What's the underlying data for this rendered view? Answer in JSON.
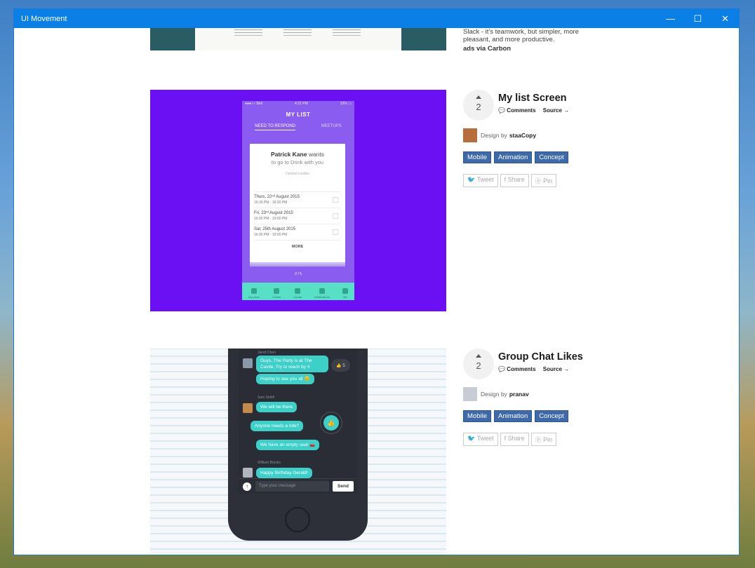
{
  "window": {
    "title": "UI Movement",
    "minimize": "—",
    "maximize": "☐",
    "close": "✕"
  },
  "ad": {
    "text": "Slack - it's teamwork, but simpler, more pleasant, and more productive.",
    "via": "ads via Carbon"
  },
  "items": [
    {
      "title": "My list Screen",
      "votes": "2",
      "comments": "Comments",
      "source": "Source →",
      "design_by": "Design by",
      "designer": "staaCopy",
      "tags": [
        "Mobile",
        "Animation",
        "Concept"
      ],
      "share": {
        "tweet": "Tweet",
        "share": "Share",
        "pin": "Pin"
      },
      "mock": {
        "status_left": "●●●○○ Bell",
        "status_time": "4:21 PM",
        "status_right": "22% ▭",
        "heading": "MY LIST",
        "tab_active": "NEED TO RESPOND",
        "tab_other": "MEETUPS",
        "person": "Patrick Kane",
        "wants": " wants",
        "goal": "to go to  Drink  with you",
        "location": "Central London",
        "rows": [
          {
            "date": "Thurs, 22ⁿᵈ August 2015",
            "time": "19:30 PM - 19:30 PM"
          },
          {
            "date": "Fri, 23ʳᵈ August 2015",
            "time": "16:00 PM - 19:00 PM"
          },
          {
            "date": "Sat, 25th August 2015",
            "time": "16:00 PM - 19:00 PM"
          }
        ],
        "more": "MORE",
        "pager": "2 / 5",
        "nav": [
          "My plans",
          "Circles",
          "Create",
          "Notifications",
          "Me"
        ]
      }
    },
    {
      "title": "Group Chat Likes",
      "votes": "2",
      "comments": "Comments",
      "source": "Source →",
      "design_by": "Design by",
      "designer": "pranav",
      "tags": [
        "Mobile",
        "Animation",
        "Concept"
      ],
      "share": {
        "tweet": "Tweet",
        "share": "Share",
        "pin": "Pin"
      },
      "mock": {
        "sender1": "Jared Chen",
        "msg1": "Guys, The Party is at The Castle, Try to reach by 4",
        "msg2": "Hoping to see you all 😊",
        "likes": "👍 5",
        "sender2": "Sam Smith",
        "msg3": "We will be there",
        "msg4": "Anyone needs a ride?",
        "msg5": "We have an empty seat 🚗",
        "sender3": "William Brooks",
        "msg6": "Happy Birthday Gerald!",
        "placeholder": "Type your message",
        "send": "Send"
      }
    }
  ],
  "colors": {
    "titlebar": "#0a7fe6",
    "tag": "#3e6aa9",
    "purple_bg": "#6b10f2",
    "nav_teal": "#57e0c5",
    "bubble": "#3dd0c8"
  }
}
